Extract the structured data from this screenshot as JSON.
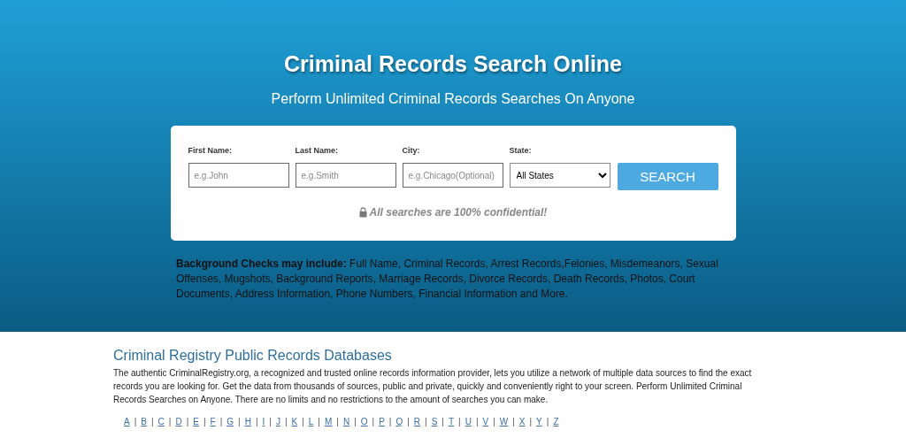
{
  "hero": {
    "title": "Criminal Records Search Online",
    "subtitle": "Perform Unlimited Criminal Records Searches On Anyone"
  },
  "search_form": {
    "fields": [
      {
        "kind": "text",
        "label": "First Name:",
        "placeholder": "e.g.John"
      },
      {
        "kind": "text",
        "label": "Last Name:",
        "placeholder": "e.g.Smith"
      },
      {
        "kind": "text",
        "label": "City:",
        "placeholder": "e.g.Chicago(Optional)"
      },
      {
        "kind": "select",
        "label": "State:",
        "value": "All States"
      }
    ],
    "button": "SEARCH",
    "note": "All searches are 100% confidential!"
  },
  "includes": "**Background Checks may include:** Full Name, Criminal Records, Arrest Records,Felonies, Misdemeanors, Sexual Offenses, Mugshots, Background Reports, Marriage Records, Divorce Records, Death Records, Photos, Court Documents, Address Information, Phone Numbers, Financial Information and More.",
  "section": {
    "heading": "Criminal Registry Public Records Databases",
    "body": "The authentic CriminalRegistry.org, a recognized and trusted online records information provider, lets you utilize a network of multiple data sources to find the exact records you are looking for. Get the data from thousands of sources, public and private, quickly and conveniently right to your screen. Perform Unlimited Criminal Records Searches on Anyone. There are no limits and no restrictions to the amount of searches you can make."
  },
  "alphabet": [
    {
      "letter": "A",
      "separator": "|"
    },
    {
      "letter": "B",
      "separator": "|"
    },
    {
      "letter": "C",
      "separator": "|"
    },
    {
      "letter": "D",
      "separator": "|"
    },
    {
      "letter": "E",
      "separator": "|"
    },
    {
      "letter": "F",
      "separator": "|"
    },
    {
      "letter": "G",
      "separator": "|"
    },
    {
      "letter": "H",
      "separator": "|"
    },
    {
      "letter": "I",
      "separator": "|"
    },
    {
      "letter": "J",
      "separator": "|"
    },
    {
      "letter": "K",
      "separator": "|"
    },
    {
      "letter": "L",
      "separator": "|"
    },
    {
      "letter": "M",
      "separator": "|"
    },
    {
      "letter": "N",
      "separator": "|"
    },
    {
      "letter": "O",
      "separator": "|"
    },
    {
      "letter": "P",
      "separator": "|"
    },
    {
      "letter": "Q",
      "separator": "|"
    },
    {
      "letter": "R",
      "separator": "|"
    },
    {
      "letter": "S",
      "separator": "|"
    },
    {
      "letter": "T",
      "separator": "|"
    },
    {
      "letter": "U",
      "separator": "|"
    },
    {
      "letter": "V",
      "separator": "|"
    },
    {
      "letter": "W",
      "separator": "|"
    },
    {
      "letter": "X",
      "separator": "|"
    },
    {
      "letter": "Y",
      "separator": "|"
    },
    {
      "letter": "Z"
    }
  ]
}
